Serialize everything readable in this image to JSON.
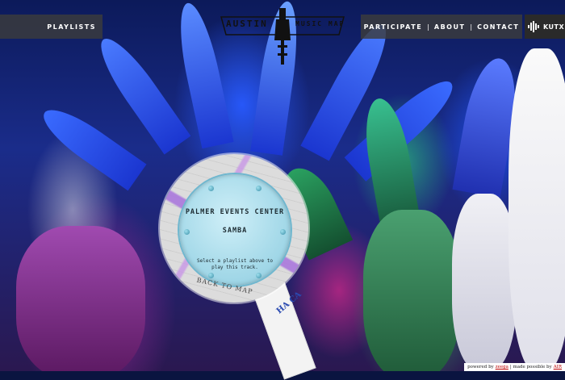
{
  "nav": {
    "playlists": "PLAYLISTS",
    "participate": "PARTICIPATE",
    "about": "ABOUT",
    "contact": "CONTACT",
    "separator": "|"
  },
  "logo": {
    "left": "AUSTIN",
    "right": "MUSIC MAP"
  },
  "sponsor": {
    "name": "KUTX"
  },
  "player": {
    "venue": "PALMER EVENTS CENTER",
    "genre": "SAMBA",
    "hint": "Select a playlist above to play this track.",
    "map_label": "BACK TO MAP"
  },
  "sash_text": "HA CA",
  "footer": {
    "powered_prefix": "powered by",
    "powered_link": "zeega",
    "made_possible": "| made possible by",
    "sponsor_link": "AIR"
  },
  "colors": {
    "nav_bg": "#3c3c3c",
    "inner_circle": "#a8dbea",
    "ring": "#6fb7cf",
    "link_red": "#bb0000"
  }
}
